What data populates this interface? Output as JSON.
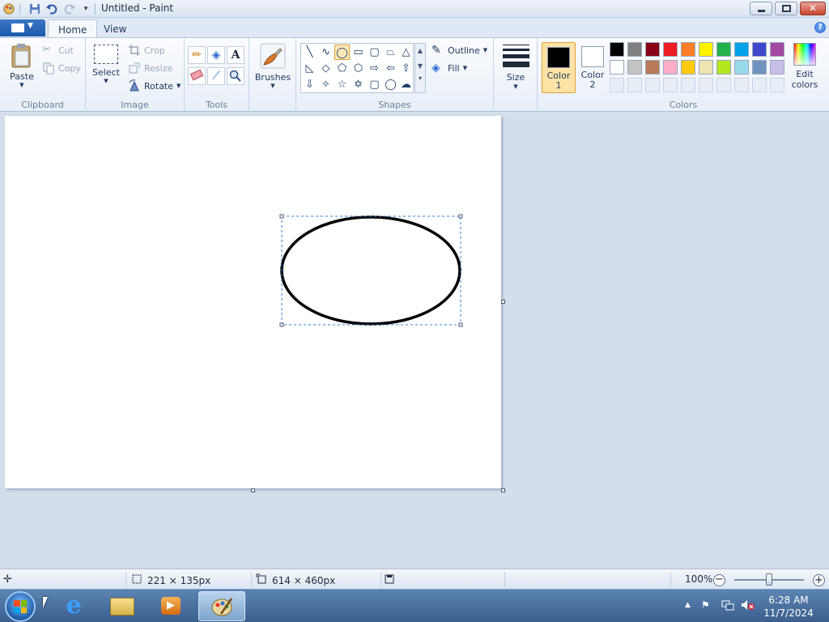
{
  "window": {
    "title": "Untitled - Paint"
  },
  "tabs": [
    {
      "label": "Home"
    },
    {
      "label": "View"
    }
  ],
  "help": {
    "label": "?"
  },
  "clipboard": {
    "group": "Clipboard",
    "paste": "Paste",
    "cut": "Cut",
    "copy": "Copy"
  },
  "image": {
    "group": "Image",
    "select": "Select",
    "crop": "Crop",
    "resize": "Resize",
    "rotate": "Rotate"
  },
  "tools": {
    "group": "Tools",
    "text_glyph": "A"
  },
  "brushes": {
    "label": "Brushes"
  },
  "shapes": {
    "group": "Shapes",
    "outline": "Outline",
    "fill": "Fill",
    "selected_shape": "oval"
  },
  "size": {
    "label": "Size"
  },
  "colors": {
    "group": "Colors",
    "color1": "Color\n1",
    "color1_l1": "Color",
    "color1_l2": "1",
    "color2_l1": "Color",
    "color2_l2": "2",
    "edit_l1": "Edit",
    "edit_l2": "colors",
    "color1_value": "#000000",
    "color2_value": "#ffffff",
    "palette_row1": [
      "#000000",
      "#7f7f7f",
      "#880015",
      "#ed1c24",
      "#ff7f27",
      "#fff200",
      "#22b14c",
      "#00a2e8",
      "#3f48cc",
      "#a349a4"
    ],
    "palette_row2": [
      "#ffffff",
      "#c3c3c3",
      "#b97a57",
      "#ffaec9",
      "#ffc90e",
      "#efe4b0",
      "#b5e61d",
      "#99d9ea",
      "#7092be",
      "#c8bfe7"
    ]
  },
  "status": {
    "selection_size": "221 × 135px",
    "image_size": "614 × 460px",
    "zoom": "100%"
  },
  "taskbar": {
    "time": "6:28 AM",
    "date": "11/7/2024"
  }
}
